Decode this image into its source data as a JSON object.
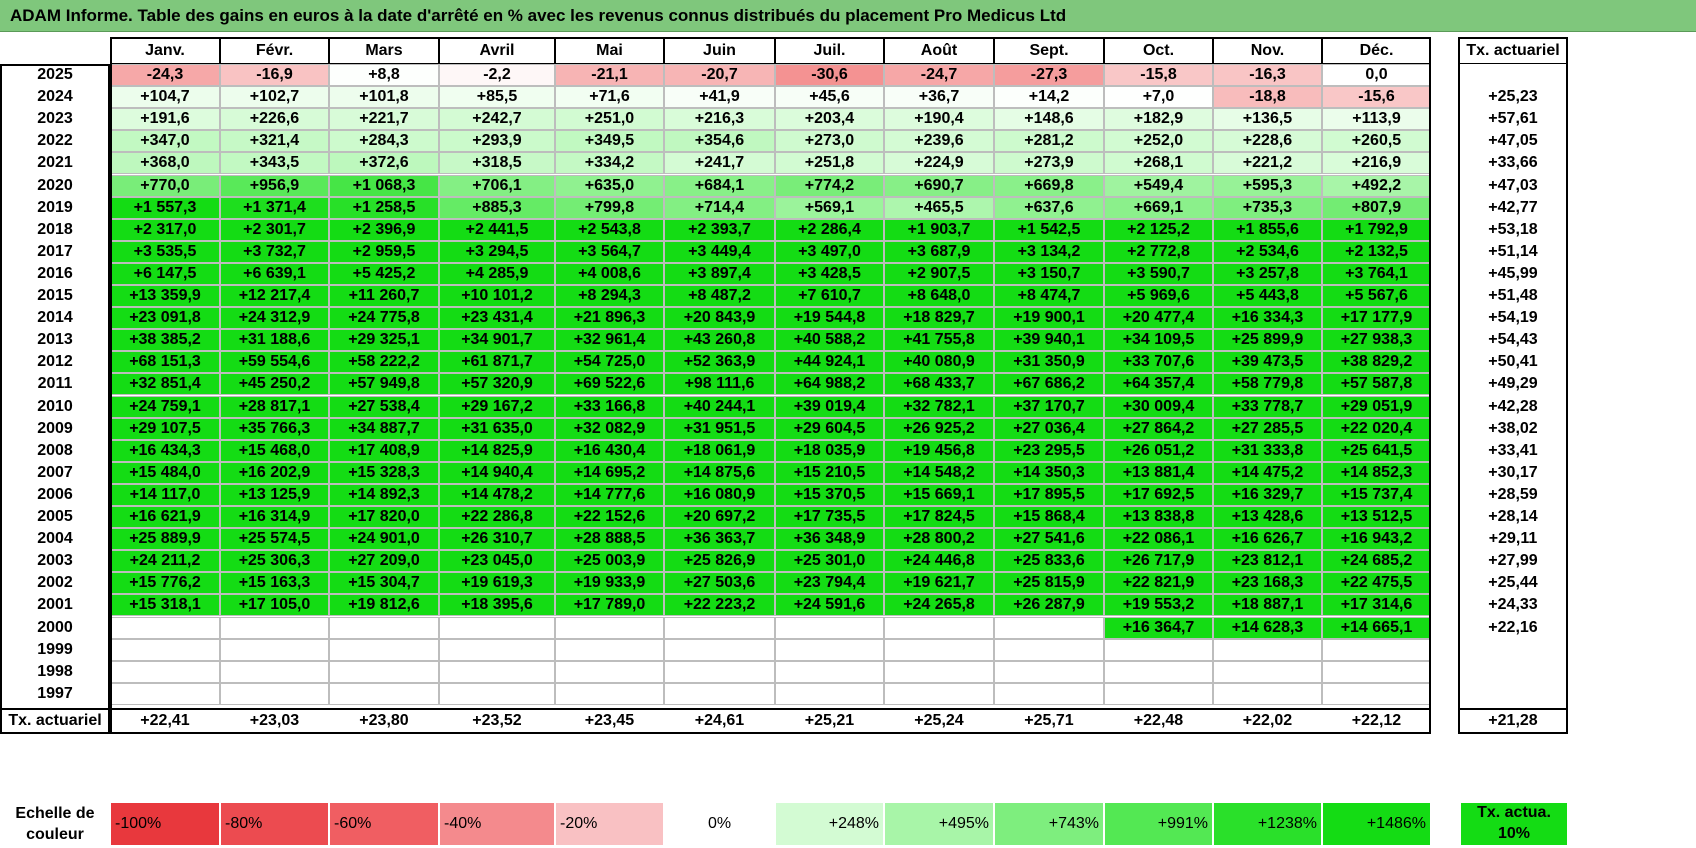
{
  "title": "ADAM Informe. Table des gains en euros à la date d'arrêté en % avec les revenus connus distribués du placement Pro Medicus Ltd",
  "months": [
    "Janv.",
    "Févr.",
    "Mars",
    "Avril",
    "Mai",
    "Juin",
    "Juil.",
    "Août",
    "Sept.",
    "Oct.",
    "Nov.",
    "Déc."
  ],
  "rate_header": "Tx. actuariel",
  "rows": [
    {
      "year": "2025",
      "values": [
        "-24,3",
        "-16,9",
        "+8,8",
        "-2,2",
        "-21,1",
        "-20,7",
        "-30,6",
        "-24,7",
        "-27,3",
        "-15,8",
        "-16,3",
        "0,0"
      ],
      "rate": ""
    },
    {
      "year": "2024",
      "values": [
        "+104,7",
        "+102,7",
        "+101,8",
        "+85,5",
        "+71,6",
        "+41,9",
        "+45,6",
        "+36,7",
        "+14,2",
        "+7,0",
        "-18,8",
        "-15,6"
      ],
      "rate": "+25,23"
    },
    {
      "year": "2023",
      "values": [
        "+191,6",
        "+226,6",
        "+221,7",
        "+242,7",
        "+251,0",
        "+216,3",
        "+203,4",
        "+190,4",
        "+148,6",
        "+182,9",
        "+136,5",
        "+113,9"
      ],
      "rate": "+57,61"
    },
    {
      "year": "2022",
      "values": [
        "+347,0",
        "+321,4",
        "+284,3",
        "+293,9",
        "+349,5",
        "+354,6",
        "+273,0",
        "+239,6",
        "+281,2",
        "+252,0",
        "+228,6",
        "+260,5"
      ],
      "rate": "+47,05"
    },
    {
      "year": "2021",
      "values": [
        "+368,0",
        "+343,5",
        "+372,6",
        "+318,5",
        "+334,2",
        "+241,7",
        "+251,8",
        "+224,9",
        "+273,9",
        "+268,1",
        "+221,2",
        "+216,9"
      ],
      "rate": "+33,66"
    },
    {
      "year": "2020",
      "values": [
        "+770,0",
        "+956,9",
        "+1 068,3",
        "+706,1",
        "+635,0",
        "+684,1",
        "+774,2",
        "+690,7",
        "+669,8",
        "+549,4",
        "+595,3",
        "+492,2"
      ],
      "rate": "+47,03"
    },
    {
      "year": "2019",
      "values": [
        "+1 557,3",
        "+1 371,4",
        "+1 258,5",
        "+885,3",
        "+799,8",
        "+714,4",
        "+569,1",
        "+465,5",
        "+637,6",
        "+669,1",
        "+735,3",
        "+807,9"
      ],
      "rate": "+42,77"
    },
    {
      "year": "2018",
      "values": [
        "+2 317,0",
        "+2 301,7",
        "+2 396,9",
        "+2 441,5",
        "+2 543,8",
        "+2 393,7",
        "+2 286,4",
        "+1 903,7",
        "+1 542,5",
        "+2 125,2",
        "+1 855,6",
        "+1 792,9"
      ],
      "rate": "+53,18"
    },
    {
      "year": "2017",
      "values": [
        "+3 535,5",
        "+3 732,7",
        "+2 959,5",
        "+3 294,5",
        "+3 564,7",
        "+3 449,4",
        "+3 497,0",
        "+3 687,9",
        "+3 134,2",
        "+2 772,8",
        "+2 534,6",
        "+2 132,5"
      ],
      "rate": "+51,14"
    },
    {
      "year": "2016",
      "values": [
        "+6 147,5",
        "+6 639,1",
        "+5 425,2",
        "+4 285,9",
        "+4 008,6",
        "+3 897,4",
        "+3 428,5",
        "+2 907,5",
        "+3 150,7",
        "+3 590,7",
        "+3 257,8",
        "+3 764,1"
      ],
      "rate": "+45,99"
    },
    {
      "year": "2015",
      "values": [
        "+13 359,9",
        "+12 217,4",
        "+11 260,7",
        "+10 101,2",
        "+8 294,3",
        "+8 487,2",
        "+7 610,7",
        "+8 648,0",
        "+8 474,7",
        "+5 969,6",
        "+5 443,8",
        "+5 567,6"
      ],
      "rate": "+51,48"
    },
    {
      "year": "2014",
      "values": [
        "+23 091,8",
        "+24 312,9",
        "+24 775,8",
        "+23 431,4",
        "+21 896,3",
        "+20 843,9",
        "+19 544,8",
        "+18 829,7",
        "+19 900,1",
        "+20 477,4",
        "+16 334,3",
        "+17 177,9"
      ],
      "rate": "+54,19"
    },
    {
      "year": "2013",
      "values": [
        "+38 385,2",
        "+31 188,6",
        "+29 325,1",
        "+34 901,7",
        "+32 961,4",
        "+43 260,8",
        "+40 588,2",
        "+41 755,8",
        "+39 940,1",
        "+34 109,5",
        "+25 899,9",
        "+27 938,3"
      ],
      "rate": "+54,43"
    },
    {
      "year": "2012",
      "values": [
        "+68 151,3",
        "+59 554,6",
        "+58 222,2",
        "+61 871,7",
        "+54 725,0",
        "+52 363,9",
        "+44 924,1",
        "+40 080,9",
        "+31 350,9",
        "+33 707,6",
        "+39 473,5",
        "+38 829,2"
      ],
      "rate": "+50,41"
    },
    {
      "year": "2011",
      "values": [
        "+32 851,4",
        "+45 250,2",
        "+57 949,8",
        "+57 320,9",
        "+69 522,6",
        "+98 111,6",
        "+64 988,2",
        "+68 433,7",
        "+67 686,2",
        "+64 357,4",
        "+58 779,8",
        "+57 587,8"
      ],
      "rate": "+49,29"
    },
    {
      "year": "2010",
      "values": [
        "+24 759,1",
        "+28 817,1",
        "+27 538,4",
        "+29 167,2",
        "+33 166,8",
        "+40 244,1",
        "+39 019,4",
        "+32 782,1",
        "+37 170,7",
        "+30 009,4",
        "+33 778,7",
        "+29 051,9"
      ],
      "rate": "+42,28"
    },
    {
      "year": "2009",
      "values": [
        "+29 107,5",
        "+35 766,3",
        "+34 887,7",
        "+31 635,0",
        "+32 082,9",
        "+31 951,5",
        "+29 604,5",
        "+26 925,2",
        "+27 036,4",
        "+27 864,2",
        "+27 285,5",
        "+22 020,4"
      ],
      "rate": "+38,02"
    },
    {
      "year": "2008",
      "values": [
        "+16 434,3",
        "+15 468,0",
        "+17 408,9",
        "+14 825,9",
        "+16 430,4",
        "+18 061,9",
        "+18 035,9",
        "+19 456,8",
        "+23 295,5",
        "+26 051,2",
        "+31 333,8",
        "+25 641,5"
      ],
      "rate": "+33,41"
    },
    {
      "year": "2007",
      "values": [
        "+15 484,0",
        "+16 202,9",
        "+15 328,3",
        "+14 940,4",
        "+14 695,2",
        "+14 875,6",
        "+15 210,5",
        "+14 548,2",
        "+14 350,3",
        "+13 881,4",
        "+14 475,2",
        "+14 852,3"
      ],
      "rate": "+30,17"
    },
    {
      "year": "2006",
      "values": [
        "+14 117,0",
        "+13 125,9",
        "+14 892,3",
        "+14 478,2",
        "+14 777,6",
        "+16 080,9",
        "+15 370,5",
        "+15 669,1",
        "+17 895,5",
        "+17 692,5",
        "+16 329,7",
        "+15 737,4"
      ],
      "rate": "+28,59"
    },
    {
      "year": "2005",
      "values": [
        "+16 621,9",
        "+16 314,9",
        "+17 820,0",
        "+22 286,8",
        "+22 152,6",
        "+20 697,2",
        "+17 735,5",
        "+17 824,5",
        "+15 868,4",
        "+13 838,8",
        "+13 428,6",
        "+13 512,5"
      ],
      "rate": "+28,14"
    },
    {
      "year": "2004",
      "values": [
        "+25 889,9",
        "+25 574,5",
        "+24 901,0",
        "+26 310,7",
        "+28 888,5",
        "+36 363,7",
        "+36 348,9",
        "+28 800,2",
        "+27 541,6",
        "+22 086,1",
        "+16 626,7",
        "+16 943,2"
      ],
      "rate": "+29,11"
    },
    {
      "year": "2003",
      "values": [
        "+24 211,2",
        "+25 306,3",
        "+27 209,0",
        "+23 045,0",
        "+25 003,9",
        "+25 826,9",
        "+25 301,0",
        "+24 446,8",
        "+25 833,6",
        "+26 717,9",
        "+23 812,1",
        "+24 685,2"
      ],
      "rate": "+27,99"
    },
    {
      "year": "2002",
      "values": [
        "+15 776,2",
        "+15 163,3",
        "+15 304,7",
        "+19 619,3",
        "+19 933,9",
        "+27 503,6",
        "+23 794,4",
        "+19 621,7",
        "+25 815,9",
        "+22 821,9",
        "+23 168,3",
        "+22 475,5"
      ],
      "rate": "+25,44"
    },
    {
      "year": "2001",
      "values": [
        "+15 318,1",
        "+17 105,0",
        "+19 812,6",
        "+18 395,6",
        "+17 789,0",
        "+22 223,2",
        "+24 591,6",
        "+24 265,8",
        "+26 287,9",
        "+19 553,2",
        "+18 887,1",
        "+17 314,6"
      ],
      "rate": "+24,33"
    },
    {
      "year": "2000",
      "values": [
        "",
        "",
        "",
        "",
        "",
        "",
        "",
        "",
        "",
        "+16 364,7",
        "+14 628,3",
        "+14 665,1"
      ],
      "rate": "+22,16"
    },
    {
      "year": "1999",
      "values": [
        "",
        "",
        "",
        "",
        "",
        "",
        "",
        "",
        "",
        "",
        "",
        ""
      ],
      "rate": ""
    },
    {
      "year": "1998",
      "values": [
        "",
        "",
        "",
        "",
        "",
        "",
        "",
        "",
        "",
        "",
        "",
        ""
      ],
      "rate": ""
    },
    {
      "year": "1997",
      "values": [
        "",
        "",
        "",
        "",
        "",
        "",
        "",
        "",
        "",
        "",
        "",
        ""
      ],
      "rate": ""
    }
  ],
  "footer": {
    "label": "Tx. actuariel",
    "values": [
      "+22,41",
      "+23,03",
      "+23,80",
      "+23,52",
      "+23,45",
      "+24,61",
      "+25,21",
      "+25,24",
      "+25,71",
      "+22,48",
      "+22,02",
      "+22,12"
    ],
    "total": "+21,28"
  },
  "legend": {
    "label": "Echelle de couleur",
    "items": [
      {
        "label": "-100%",
        "color": "#e8383d"
      },
      {
        "label": "-80%",
        "color": "#ec4b50"
      },
      {
        "label": "-60%",
        "color": "#f05e62"
      },
      {
        "label": "-40%",
        "color": "#f48a8d"
      },
      {
        "label": "-20%",
        "color": "#f9c1c3"
      },
      {
        "label": "0%",
        "color": "#ffffff"
      },
      {
        "label": "+248%",
        "color": "#d3fbd3"
      },
      {
        "label": "+495%",
        "color": "#a8f5a8"
      },
      {
        "label": "+743%",
        "color": "#7eee7e"
      },
      {
        "label": "+991%",
        "color": "#53e853"
      },
      {
        "label": "+1238%",
        "color": "#2ae02a"
      },
      {
        "label": "+1486%",
        "color": "#14dc14"
      }
    ],
    "rate_label": "Tx. actua. 10%",
    "rate_color": "#14dc14"
  }
}
